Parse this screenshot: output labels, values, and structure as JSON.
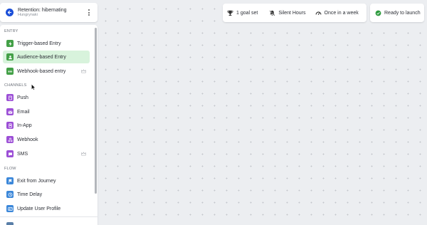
{
  "journey": {
    "title": "Retention: hibernating",
    "subtitle": "Hungrynaki"
  },
  "sidebar": {
    "sections": [
      {
        "label": "ENTRY",
        "items": [
          {
            "label": "Trigger-based Entry",
            "icon": "lightning-icon",
            "color": "#43a047"
          },
          {
            "label": "Audience-based Entry",
            "icon": "audience-icon",
            "color": "#43a047",
            "active": true
          },
          {
            "label": "Webhook-based entry",
            "icon": "api-icon",
            "color": "#43a047",
            "premium": true
          }
        ]
      },
      {
        "label": "CHANNELS",
        "items": [
          {
            "label": "Push",
            "icon": "push-icon",
            "color": "#9c4fd6"
          },
          {
            "label": "Email",
            "icon": "email-icon",
            "color": "#9c4fd6"
          },
          {
            "label": "In-App",
            "icon": "in-app-icon",
            "color": "#9c4fd6"
          },
          {
            "label": "Webhook",
            "icon": "webhook-icon",
            "color": "#9c4fd6"
          },
          {
            "label": "SMS",
            "icon": "sms-icon",
            "color": "#9c4fd6",
            "premium": true
          }
        ]
      },
      {
        "label": "FLOW",
        "items": [
          {
            "label": "Exit from Journey",
            "icon": "flag-icon",
            "color": "#3b87d9"
          },
          {
            "label": "Time Delay",
            "icon": "clock-icon",
            "color": "#3b87d9"
          },
          {
            "label": "Update User Profile",
            "icon": "profile-icon",
            "color": "#3b87d9"
          }
        ]
      }
    ]
  },
  "toolbar": {
    "goals": "1 goal set",
    "silent_hours": "Silent Hours",
    "frequency": "Once in a week",
    "status": "Ready to launch",
    "status_color": "#2e9b3f"
  }
}
